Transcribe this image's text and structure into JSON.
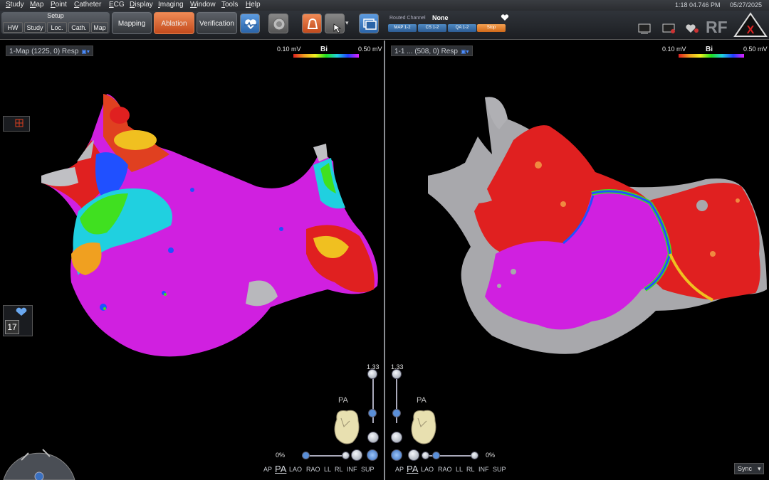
{
  "menubar": {
    "items": [
      {
        "label": "Study",
        "ul": "S",
        "rest": "tudy"
      },
      {
        "label": "Map",
        "ul": "M",
        "rest": "ap"
      },
      {
        "label": "Point",
        "ul": "P",
        "rest": "oint"
      },
      {
        "label": "Catheter",
        "ul": "C",
        "rest": "atheter"
      },
      {
        "label": "ECG",
        "ul": "E",
        "rest": "CG"
      },
      {
        "label": "Display",
        "ul": "D",
        "rest": "isplay"
      },
      {
        "label": "Imaging",
        "ul": "I",
        "rest": "maging"
      },
      {
        "label": "Window",
        "ul": "W",
        "rest": "indow"
      },
      {
        "label": "Tools",
        "ul": "T",
        "rest": "ools"
      },
      {
        "label": "Help",
        "ul": "H",
        "rest": "elp"
      }
    ],
    "time": "1:18 04.746 PM",
    "date": "05/27/2025"
  },
  "toolbar": {
    "setup_label": "Setup",
    "setup_tabs": [
      "HW",
      "Study",
      "Loc.",
      "Cath.",
      "Map"
    ],
    "modes": [
      "Mapping",
      "Ablation",
      "Verification"
    ],
    "active_mode": "Ablation",
    "routed_channel_label": "Routed Channel",
    "routed_channel_value": "None",
    "channels": [
      "MAP 1-2",
      "CS 1-2",
      "QA 1-2",
      "Stop"
    ],
    "brand": "RF",
    "colors": {
      "accent": "#d4561f",
      "channel_blue": "#3a75b0"
    }
  },
  "left_view": {
    "map_label": "1-Map (1225, 0) Resp",
    "scale_low": "0.10 mV",
    "scale_mode": "Bi",
    "scale_high": "0.50 mV",
    "zoom_value": "1.33",
    "orientation_label": "PA",
    "transparency": "0%",
    "side_counter": "17"
  },
  "right_view": {
    "map_label": "1-1 ... (508, 0) Resp",
    "scale_low": "0.10 mV",
    "scale_mode": "Bi",
    "scale_high": "0.50 mV",
    "zoom_value": "1.33",
    "orientation_label": "PA",
    "transparency": "0%",
    "sync_label": "Sync"
  },
  "views": [
    "AP",
    "PA",
    "LAO",
    "RAO",
    "LL",
    "RL",
    "INF",
    "SUP"
  ],
  "active_view": "PA",
  "icons": [
    "heart-icon",
    "catheter-icon",
    "bell-icon",
    "window-icon",
    "monitor-icon",
    "alert-icon"
  ]
}
